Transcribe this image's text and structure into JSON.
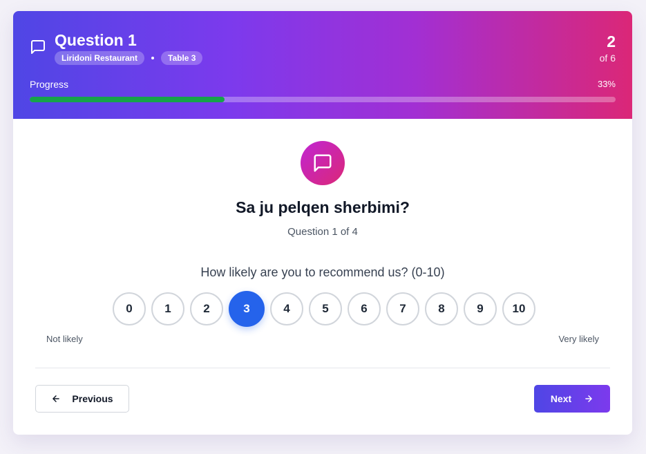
{
  "header": {
    "title": "Question 1",
    "tags": [
      "Liridoni Restaurant",
      "Table 3"
    ],
    "step_current": "2",
    "step_total": "of 6",
    "progress_label": "Progress",
    "progress_text": "33%",
    "progress_fraction": 0.333,
    "progress_color": "#16a34a",
    "icon": "chat-bubble-icon"
  },
  "question": {
    "icon": "chat-bubble-icon",
    "title": "Sa ju pelqen sherbimi?",
    "subtitle": "Question 1 of 4",
    "prompt": "How likely are you to recommend us? (0-10)",
    "scale": [
      "0",
      "1",
      "2",
      "3",
      "4",
      "5",
      "6",
      "7",
      "8",
      "9",
      "10"
    ],
    "selected": "3",
    "selected_color": "#2563eb",
    "label_low": "Not likely",
    "label_high": "Very likely"
  },
  "nav": {
    "prev_label": "Previous",
    "prev_icon": "arrow-left-icon",
    "next_label": "Next",
    "next_icon": "arrow-right-icon"
  }
}
